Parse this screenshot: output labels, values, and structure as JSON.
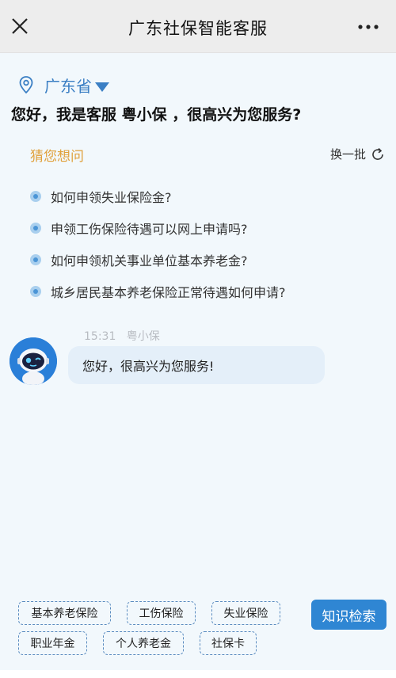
{
  "header": {
    "title": "广东社保智能客服"
  },
  "location": {
    "province": "广东省"
  },
  "greeting": "您好，我是客服 粤小保 ，很高兴为您服务?",
  "guess": {
    "title": "猜您想问",
    "refresh_label": "换一批",
    "questions": [
      "如何申领失业保险金?",
      "申领工伤保险待遇可以网上申请吗?",
      "如何申领机关事业单位基本养老金?",
      "城乡居民基本养老保险正常待遇如何申请?"
    ]
  },
  "message": {
    "time": "15:31",
    "sender": "粤小保",
    "text": "您好，很高兴为您服务!"
  },
  "quick_tags": [
    "基本养老保险",
    "工伤保险",
    "失业保险",
    "职业年金",
    "个人养老金",
    "社保卡"
  ],
  "knowledge_button": "知识检索",
  "colors": {
    "accent_blue": "#2f86d3",
    "location_blue": "#3b7fc4",
    "guess_orange": "#e0a03a",
    "bubble_bg": "#e4eff9"
  }
}
